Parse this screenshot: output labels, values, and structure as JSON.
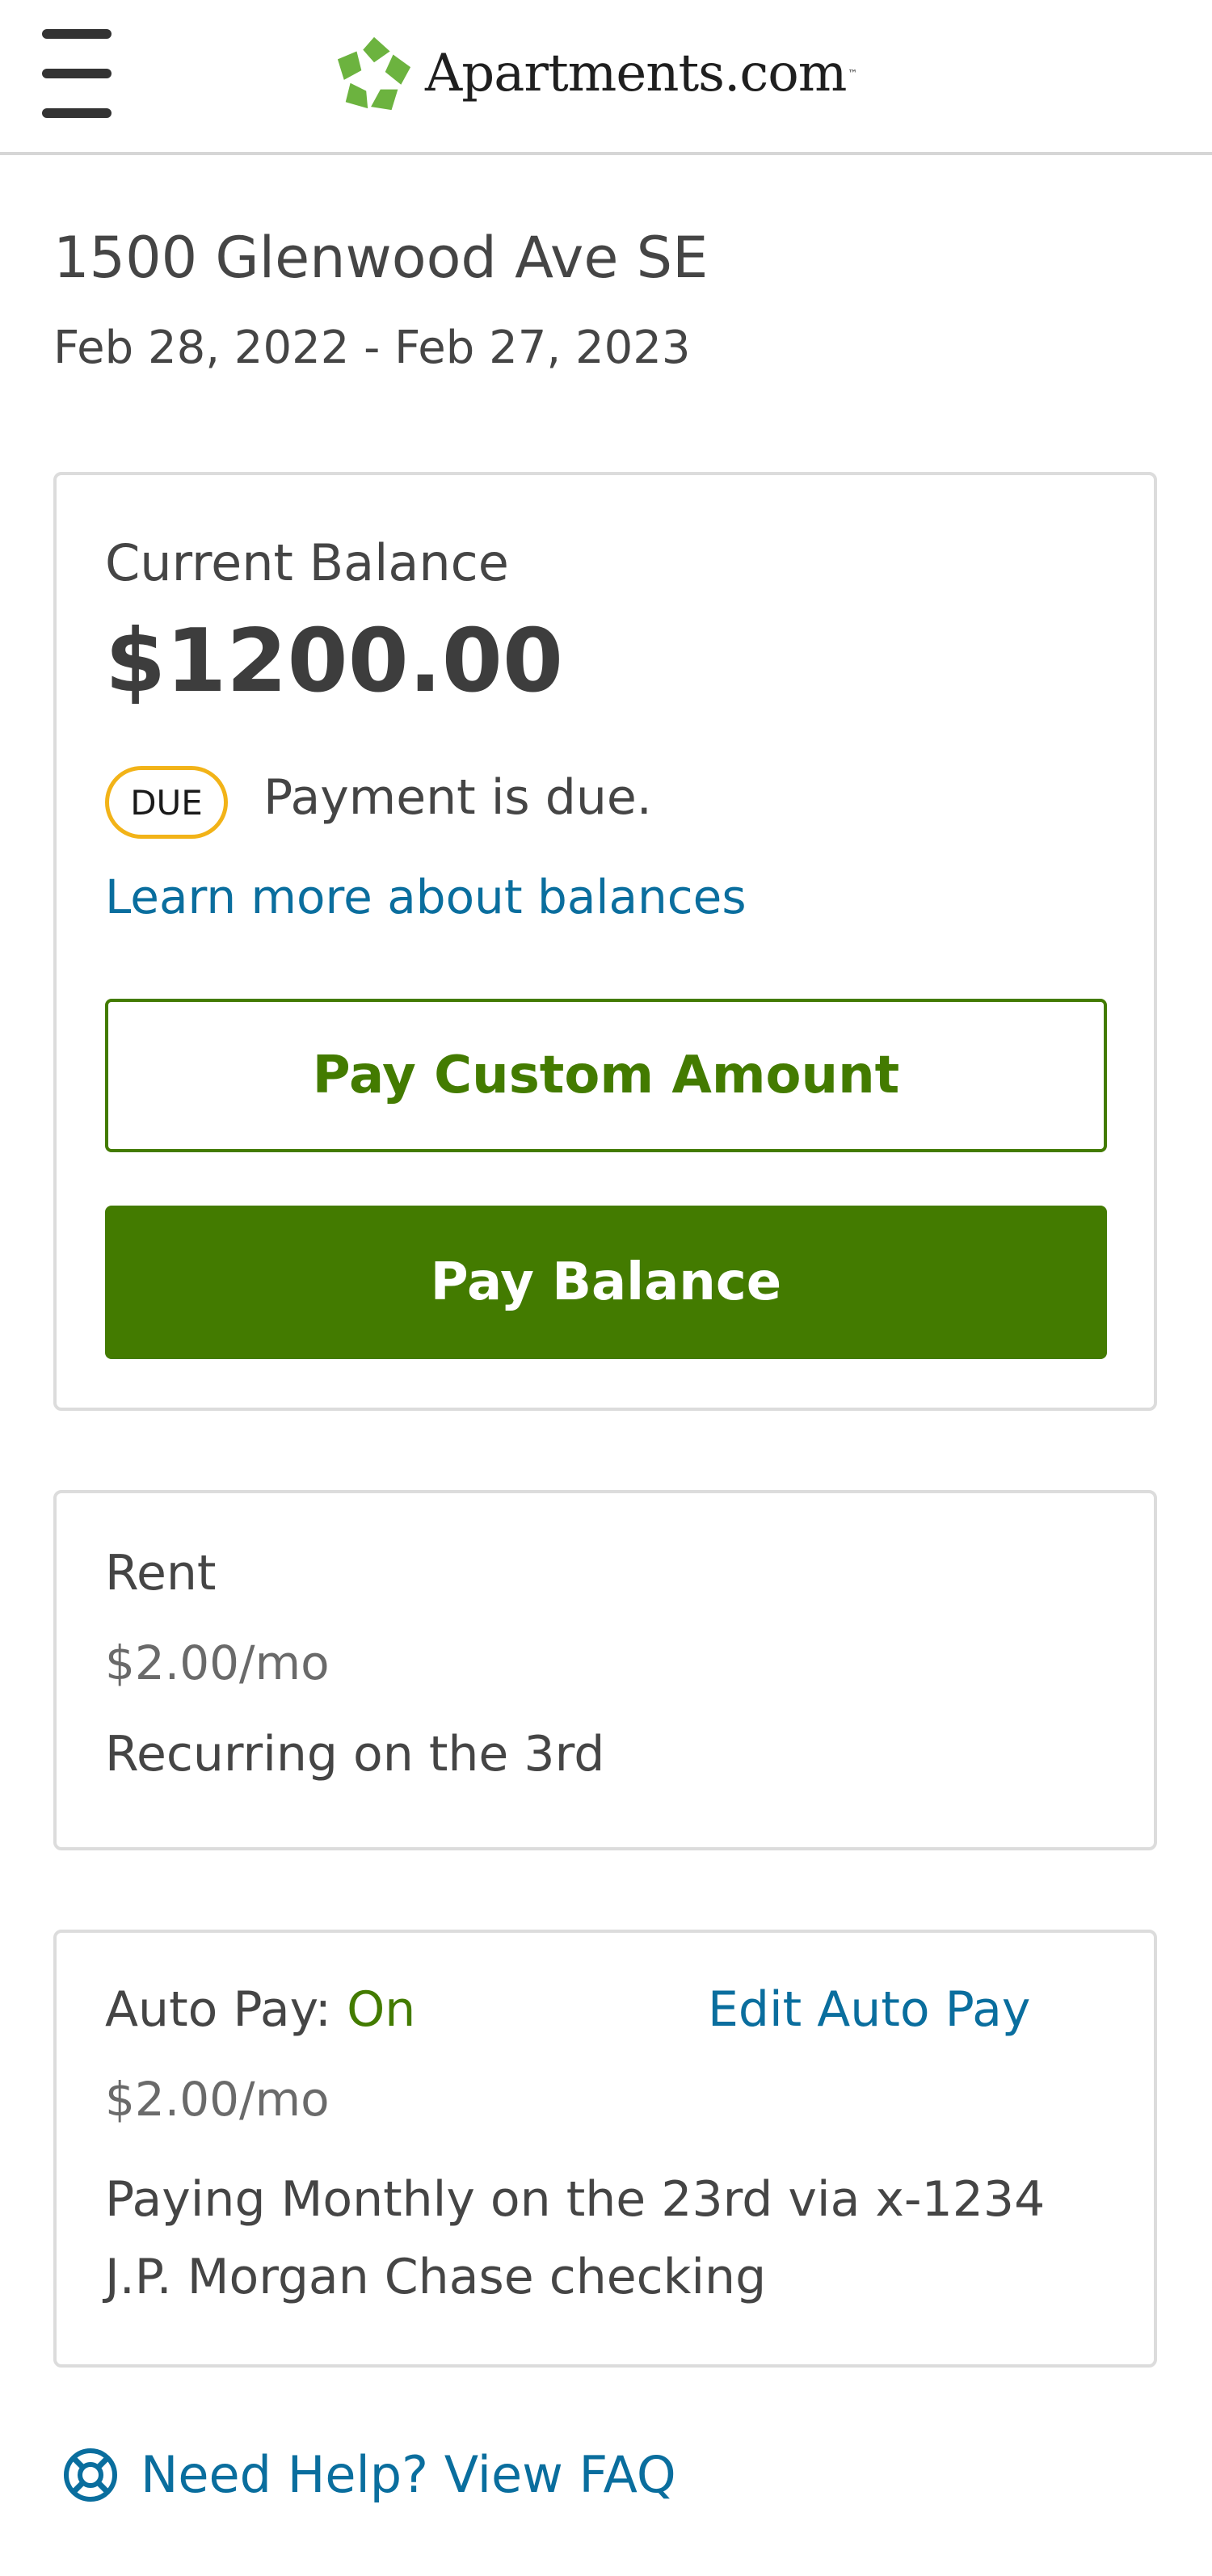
{
  "header": {
    "brand": "Apartments.com",
    "trademark": "™"
  },
  "lease": {
    "address": "1500 Glenwood Ave SE",
    "dates": "Feb 28, 2022 - Feb 27, 2023"
  },
  "balance": {
    "label": "Current Balance",
    "amount": "$1200.00",
    "badge": "DUE",
    "status_text": "Payment is due.",
    "learn_link": "Learn more about balances",
    "pay_custom_label": "Pay Custom Amount",
    "pay_balance_label": "Pay Balance"
  },
  "rent": {
    "title": "Rent",
    "amount": "$2.00/mo",
    "recurring": "Recurring on the 3rd"
  },
  "autopay": {
    "label": "Auto Pay: ",
    "status": "On",
    "edit_label": "Edit Auto Pay",
    "amount": "$2.00/mo",
    "description": "Paying Monthly on the 23rd via x-1234 J.P. Morgan Chase checking"
  },
  "help": {
    "label": "Need Help? View FAQ"
  },
  "colors": {
    "accent_green": "#437b00",
    "link_blue": "#0a6e9e",
    "badge_yellow": "#f2b318",
    "logo_green": "#6cb33f"
  },
  "icons": {
    "menu": "hamburger-menu-icon",
    "logo": "apartments-logo-icon",
    "help": "lifebuoy-icon"
  }
}
